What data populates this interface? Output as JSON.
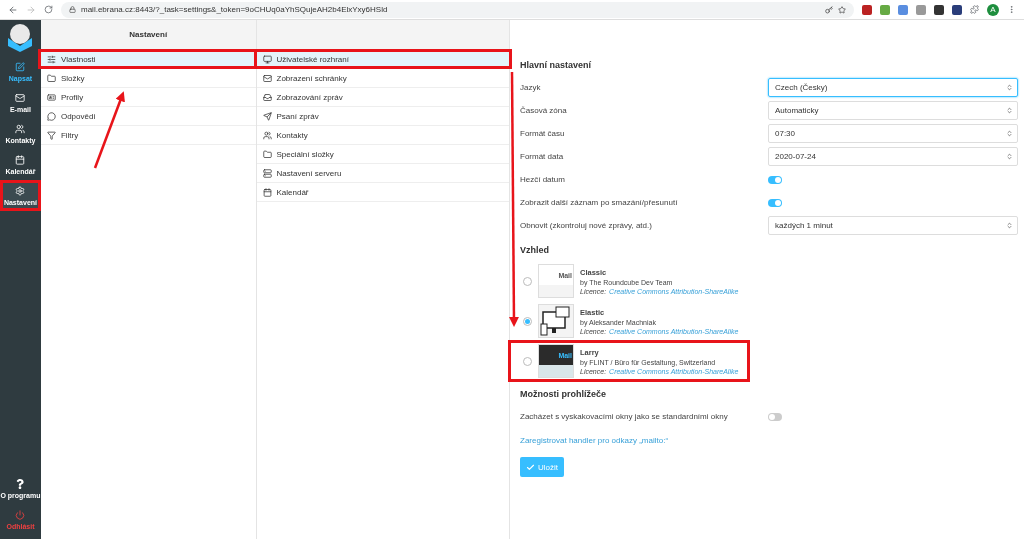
{
  "browser": {
    "url": "mail.ebrana.cz:8443/?_task=settings&_token=9oCHUq0aYhSQujeAH2b4ElxYxy6HSld",
    "avatar": "A"
  },
  "sidebar": {
    "items": [
      {
        "label": "Napsat",
        "selected": false,
        "highlighted": false,
        "kind": "compose"
      },
      {
        "label": "E-mail",
        "selected": false,
        "highlighted": false,
        "kind": "nav"
      },
      {
        "label": "Kontakty",
        "selected": false,
        "highlighted": false,
        "kind": "nav"
      },
      {
        "label": "Kalendář",
        "selected": false,
        "highlighted": false,
        "kind": "nav"
      },
      {
        "label": "Nastavení",
        "selected": true,
        "highlighted": true,
        "kind": "nav"
      }
    ],
    "bottom": [
      {
        "label": "O programu",
        "kind": "about"
      },
      {
        "label": "Odhlásit",
        "kind": "logout"
      }
    ]
  },
  "sections": {
    "title": "Nastavení",
    "items": [
      {
        "label": "Vlastnosti",
        "selected": true,
        "highlighted": true
      },
      {
        "label": "Složky",
        "selected": false,
        "highlighted": false
      },
      {
        "label": "Profily",
        "selected": false,
        "highlighted": false
      },
      {
        "label": "Odpovědi",
        "selected": false,
        "highlighted": false
      },
      {
        "label": "Filtry",
        "selected": false,
        "highlighted": false
      }
    ]
  },
  "subsections": {
    "items": [
      {
        "label": "Uživatelské rozhraní",
        "selected": true,
        "highlighted": true
      },
      {
        "label": "Zobrazení schránky",
        "selected": false,
        "highlighted": false
      },
      {
        "label": "Zobrazování zpráv",
        "selected": false,
        "highlighted": false
      },
      {
        "label": "Psaní zpráv",
        "selected": false,
        "highlighted": false
      },
      {
        "label": "Kontakty",
        "selected": false,
        "highlighted": false
      },
      {
        "label": "Speciální složky",
        "selected": false,
        "highlighted": false
      },
      {
        "label": "Nastavení serveru",
        "selected": false,
        "highlighted": false
      },
      {
        "label": "Kalendář",
        "selected": false,
        "highlighted": false
      }
    ]
  },
  "main_settings": {
    "title": "Hlavní nastavení",
    "rows": [
      {
        "label": "Jazyk",
        "kind": "select",
        "value": "Czech (Česky)",
        "focused": true
      },
      {
        "label": "Časová zóna",
        "kind": "select",
        "value": "Automaticky",
        "focused": false
      },
      {
        "label": "Formát času",
        "kind": "select",
        "value": "07:30",
        "focused": false
      },
      {
        "label": "Formát data",
        "kind": "select",
        "value": "2020-07-24",
        "focused": false
      },
      {
        "label": "Hezčí datum",
        "kind": "switch",
        "on": true
      },
      {
        "label": "Zobrazit další záznam po smazání/přesunutí",
        "kind": "switch",
        "on": true
      },
      {
        "label": "Obnovit (zkontroluj nové zprávy, atd.)",
        "kind": "select",
        "value": "každých 1 minut",
        "focused": false
      }
    ]
  },
  "appearance": {
    "title": "Vzhled",
    "themes": [
      {
        "name": "Classic",
        "author": "by The Roundcube Dev Team",
        "licence_label": "Licence:",
        "licence": "Creative Commons Attribution-ShareAlike",
        "kind": "classic",
        "preview_text": "Mail",
        "selected": false,
        "highlighted": false
      },
      {
        "name": "Elastic",
        "author": "by Aleksander Machniak",
        "licence_label": "Licence:",
        "licence": "Creative Commons Attribution-ShareAlike",
        "kind": "elastic",
        "selected": true,
        "highlighted": false
      },
      {
        "name": "Larry",
        "author": "by FLINT / Büro für Gestaltung, Switzerland",
        "licence_label": "Licence:",
        "licence": "Creative Commons Attribution-ShareAlike",
        "kind": "larry",
        "preview_text": "Mail",
        "selected": false,
        "highlighted": true
      }
    ]
  },
  "browser_options": {
    "title": "Možnosti prohlížeče",
    "rows": [
      {
        "label": "Zacházet s vyskakovacími okny jako se standardními okny",
        "on": false
      }
    ],
    "link": "Zaregistrovat handler pro odkazy „mailto:“"
  },
  "save_button": "Uložit"
}
